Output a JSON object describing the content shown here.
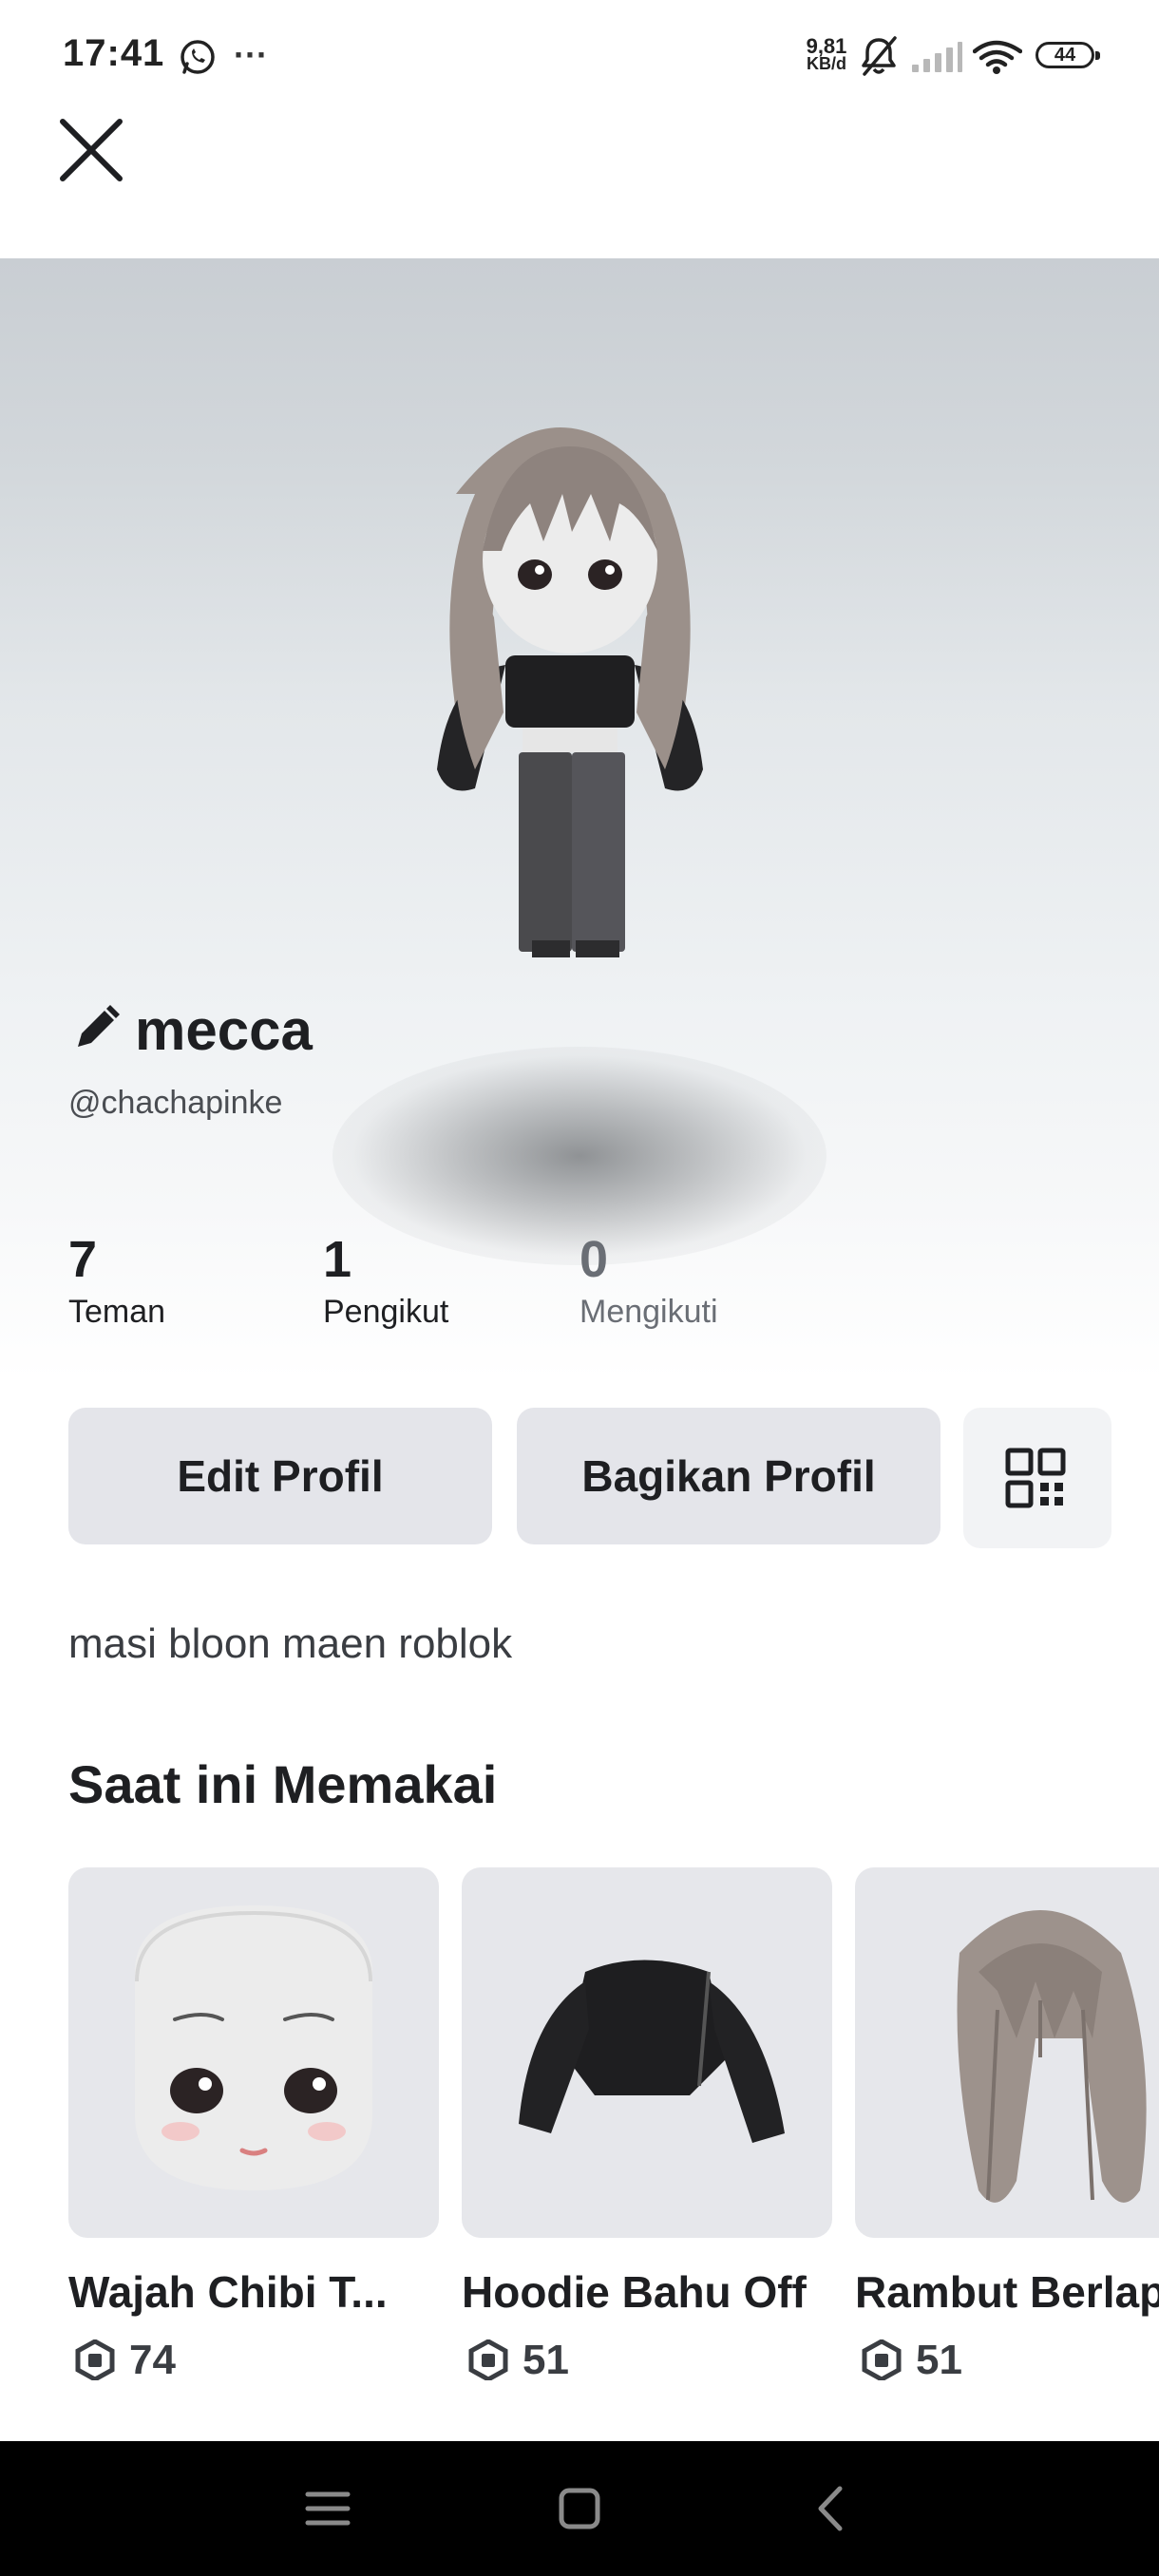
{
  "status_bar": {
    "time": "17:41",
    "net_speed": "9,81",
    "net_unit": "KB/d",
    "battery": "44",
    "icons": [
      "whatsapp-icon",
      "more-dots-icon",
      "bell-muted-icon",
      "signal-icon",
      "wifi-icon",
      "battery-icon"
    ],
    "more": "···"
  },
  "header": {
    "close_icon": "close-icon"
  },
  "profile": {
    "display_name": "mecca",
    "username": "@chachapinke",
    "stats": [
      {
        "value": "7",
        "label": "Teman"
      },
      {
        "value": "1",
        "label": "Pengikut"
      },
      {
        "value": "0",
        "label": "Mengikuti"
      }
    ],
    "buttons": {
      "edit": "Edit Profil",
      "share": "Bagikan Profil",
      "qr_icon": "qr-code-icon"
    },
    "bio": "masi bloon maen roblok"
  },
  "wearing": {
    "title": "Saat ini Memakai",
    "items": [
      {
        "name": "Wajah Chibi T...",
        "price": "74"
      },
      {
        "name": "Hoodie Bahu Off",
        "price": "51"
      },
      {
        "name": "Rambut Berlap",
        "price": "51"
      }
    ],
    "currency_icon": "robux-icon"
  },
  "nav": {
    "icons": [
      "menu-icon",
      "home-icon",
      "back-icon"
    ]
  },
  "colors": {
    "button_bg": "#e4e5ea",
    "text": "#1e1f22",
    "muted": "#6a6e75",
    "navbar": "#000000"
  }
}
